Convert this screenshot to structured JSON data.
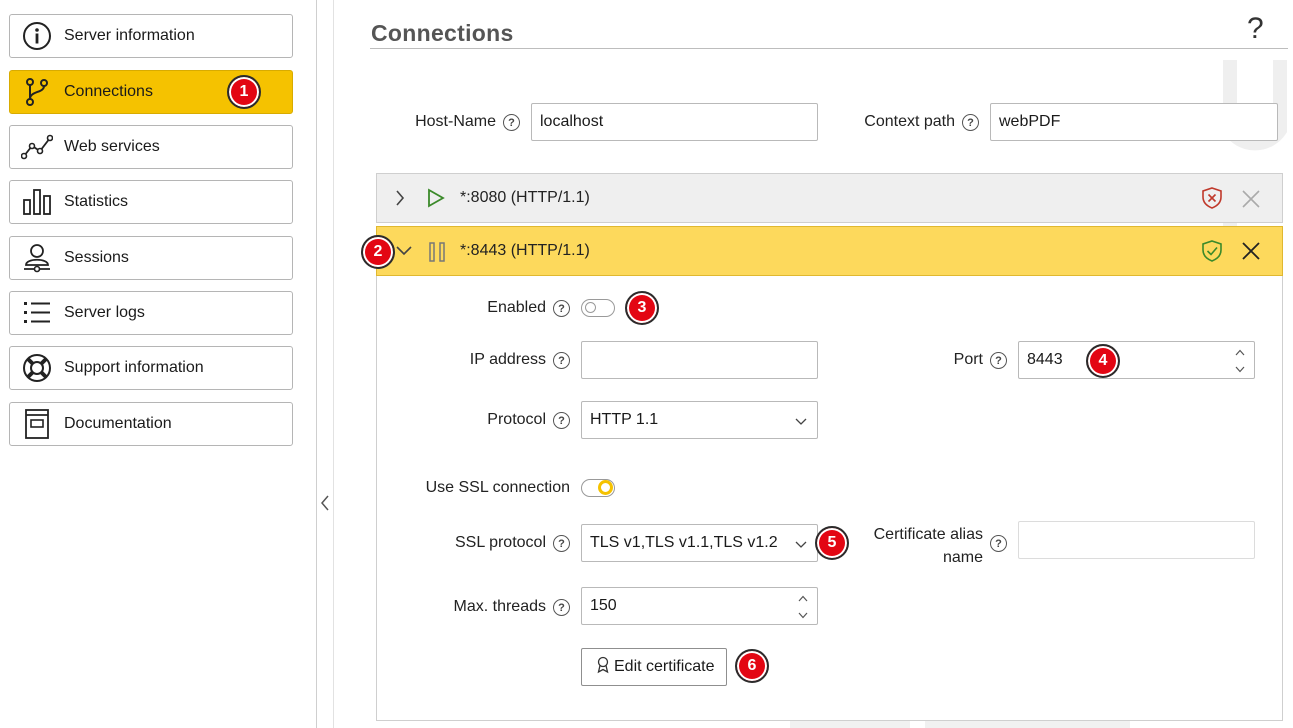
{
  "sidebar": {
    "items": [
      {
        "label": "Server information",
        "icon": "info-icon"
      },
      {
        "label": "Connections",
        "icon": "branch-icon",
        "active": true
      },
      {
        "label": "Web services",
        "icon": "graph-icon"
      },
      {
        "label": "Statistics",
        "icon": "bar-chart-icon"
      },
      {
        "label": "Sessions",
        "icon": "user-session-icon"
      },
      {
        "label": "Server logs",
        "icon": "list-icon"
      },
      {
        "label": "Support information",
        "icon": "lifebuoy-icon"
      },
      {
        "label": "Documentation",
        "icon": "book-icon"
      }
    ]
  },
  "badges": {
    "b1": "1",
    "b2": "2",
    "b3": "3",
    "b4": "4",
    "b5": "5",
    "b6": "6"
  },
  "main": {
    "title": "Connections",
    "help_symbol": "?",
    "host_name_label": "Host-Name",
    "host_name_value": "localhost",
    "context_path_label": "Context path",
    "context_path_value": "webPDF",
    "connections": [
      {
        "title": "*:8080 (HTTP/1.1)",
        "expanded": false,
        "ssl_status": "error"
      },
      {
        "title": "*:8443 (HTTP/1.1)",
        "expanded": true,
        "ssl_status": "ok"
      }
    ],
    "detail": {
      "enabled_label": "Enabled",
      "enabled": false,
      "ip_label": "IP address",
      "ip_value": "",
      "port_label": "Port",
      "port_value": "8443",
      "protocol_label": "Protocol",
      "protocol_value": "HTTP 1.1",
      "ssl_label": "Use SSL connection",
      "ssl_enabled": true,
      "ssl_protocol_label": "SSL protocol",
      "ssl_protocol_value": "TLS v1,TLS v1.1,TLS v1.2",
      "cert_alias_label_1": "Certificate alias",
      "cert_alias_label_2": "name",
      "cert_alias_value": "",
      "max_threads_label": "Max. threads",
      "max_threads_value": "150",
      "edit_cert_label": "Edit certificate"
    }
  },
  "colors": {
    "accent": "#f5c200",
    "expanded_row": "#fdd95c",
    "badge": "#e30613",
    "ok_shield": "#3b8a2a",
    "error_shield": "#c0392b"
  }
}
